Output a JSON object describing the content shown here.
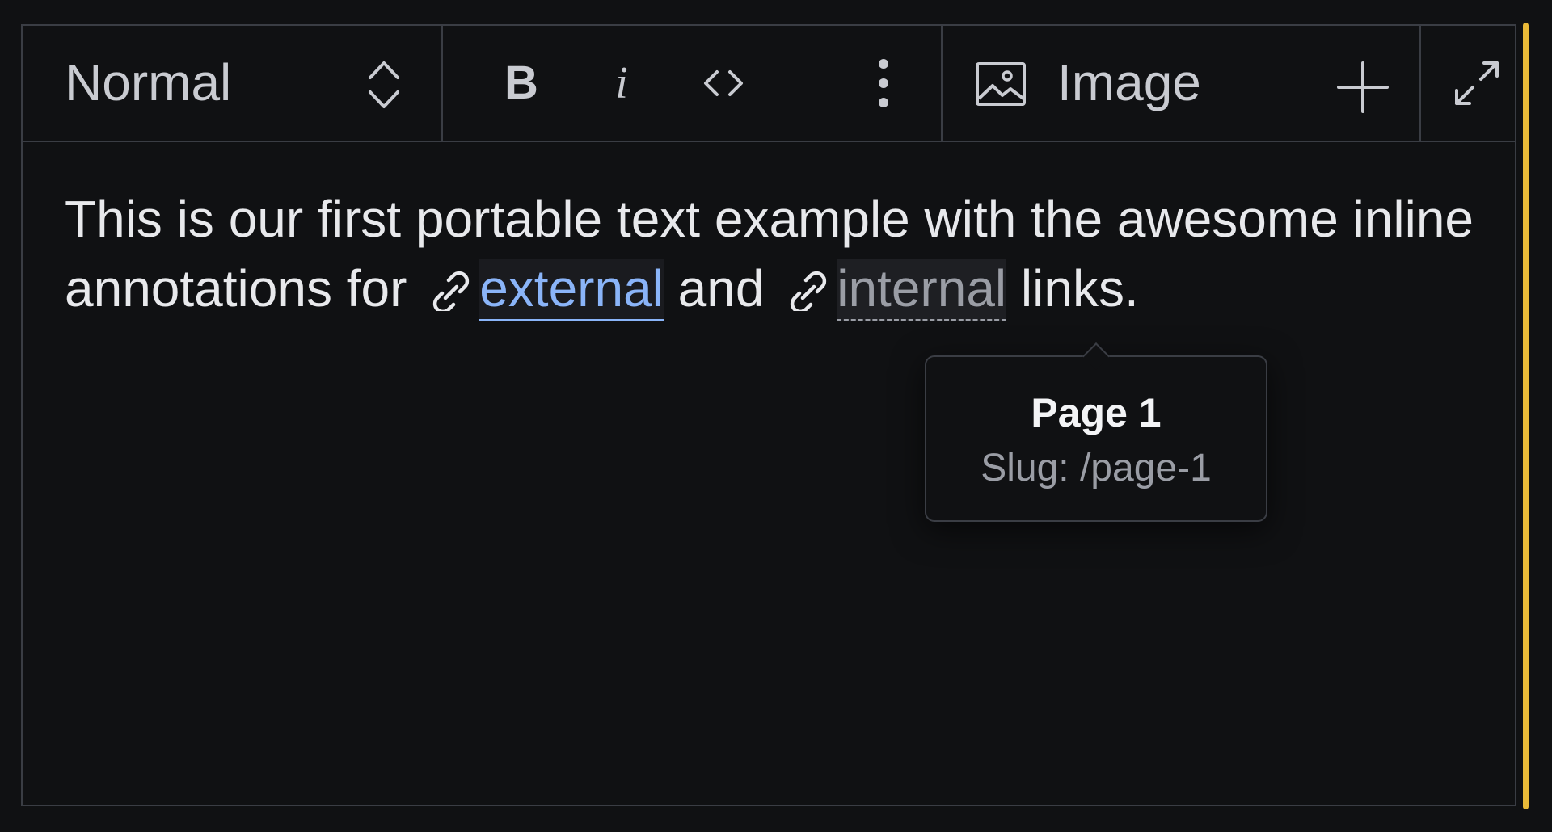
{
  "toolbar": {
    "style_select": {
      "value": "Normal",
      "icon": "chevron-up-down-icon"
    },
    "bold": {
      "label": "B",
      "icon": "bold-icon"
    },
    "italic": {
      "label": "i",
      "icon": "italic-icon"
    },
    "code": {
      "icon": "code-icon"
    },
    "more": {
      "icon": "more-vertical-icon"
    },
    "insert_image": {
      "label": "Image",
      "icon": "image-icon",
      "add_icon": "plus-icon"
    },
    "fullscreen": {
      "icon": "expand-icon"
    }
  },
  "content": {
    "part1": "This is our first portable text example with the awesome inline annotations for",
    "external_link": {
      "text": "external",
      "icon": "link-icon"
    },
    "part2": "and",
    "internal_link": {
      "text": "internal",
      "icon": "link-icon"
    },
    "part3": "links."
  },
  "tooltip": {
    "title": "Page 1",
    "slug": "Slug: /page-1"
  },
  "colors": {
    "background": "#101113",
    "border": "#3a3d44",
    "focus_accent": "#e9b938",
    "external_link": "#8ab4f8",
    "internal_link": "#9a9da5"
  }
}
